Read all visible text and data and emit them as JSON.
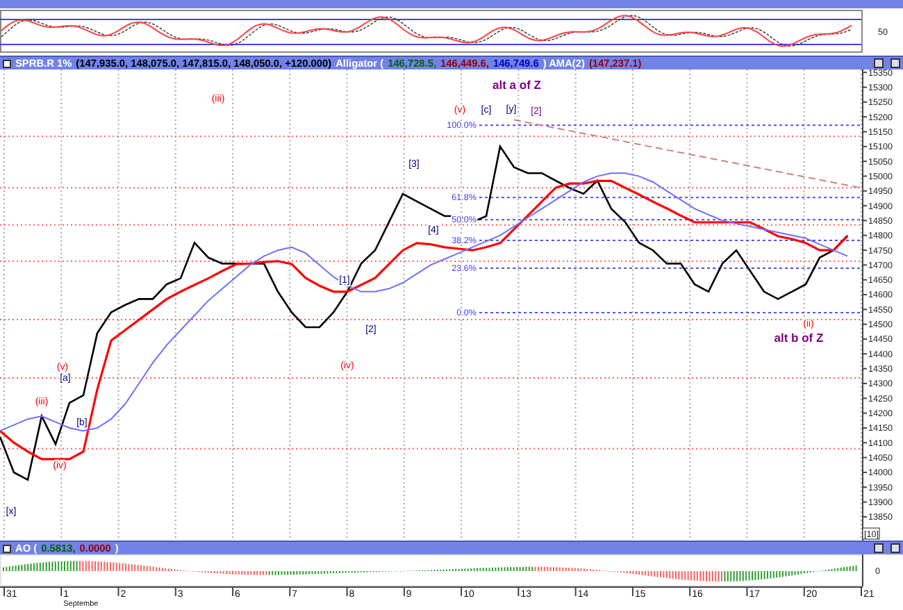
{
  "stochastic_panel": {
    "axis_labels": [
      "50"
    ]
  },
  "price_header": {
    "segments": [
      {
        "text": "SPRB.R 1%",
        "color": "#ffffff"
      },
      {
        "text": "(147,935.0, 148,075.0, 147,815.0, 148,050.0, +120.000)",
        "color": "#000000"
      },
      {
        "text": "Alligator (",
        "color": "#ffffff"
      },
      {
        "text": "146,728.5,",
        "color": "#006600"
      },
      {
        "text": "146,449.6,",
        "color": "#990000"
      },
      {
        "text": "146,749.6",
        "color": "#0000cc"
      },
      {
        "text": ") AMA(2)",
        "color": "#ffffff"
      },
      {
        "text": "(147,237.1)",
        "color": "#990000"
      }
    ]
  },
  "price_chart": {
    "axis_box": "[10]",
    "chart_data": {
      "type": "line",
      "categories": [
        null,
        null,
        null,
        null,
        null,
        null,
        null,
        null,
        null,
        null,
        null,
        null,
        null,
        null,
        null,
        null,
        null,
        null,
        null,
        null,
        null,
        null,
        null,
        null,
        null,
        null,
        null,
        null,
        null,
        null,
        null,
        null,
        null,
        null,
        null,
        null,
        null,
        null,
        null,
        null,
        null,
        null,
        null,
        null,
        null,
        null,
        null,
        null,
        null,
        null,
        null,
        null,
        null,
        null,
        null,
        null,
        null,
        null,
        null,
        null,
        null,
        null
      ],
      "series": [
        {
          "color": "#000000",
          "values": [
            14120,
            14000,
            13975,
            14190,
            14095,
            14235,
            14260,
            14470,
            14540,
            14565,
            14585,
            14585,
            14635,
            14655,
            14775,
            14725,
            14705,
            14705,
            14705,
            14705,
            14610,
            14540,
            14490,
            14490,
            14540,
            14610,
            14705,
            14750,
            14845,
            14940,
            14915,
            14890,
            14865,
            14865,
            14845,
            14865,
            15100,
            15030,
            15010,
            15010,
            14985,
            14960,
            14940,
            14985,
            14890,
            14845,
            14775,
            14750,
            14705,
            14705,
            14635,
            14610,
            14705,
            14750,
            14680,
            14610,
            14585,
            14610,
            14635,
            14725,
            14750,
            14800
          ]
        },
        {
          "color": "#ff0000",
          "values": [
            14140,
            14100,
            14070,
            14045,
            14045,
            14045,
            14070,
            14280,
            14445,
            14480,
            14515,
            14550,
            14585,
            14610,
            14633,
            14655,
            14680,
            14703,
            14705,
            14710,
            14713,
            14703,
            14656,
            14630,
            14610,
            14610,
            14633,
            14656,
            14703,
            14750,
            14774,
            14770,
            14760,
            14755,
            14750,
            14760,
            14774,
            14821,
            14867,
            14914,
            14961,
            14975,
            14975,
            14984,
            14984,
            14961,
            14938,
            14914,
            14891,
            14867,
            14844,
            14844,
            14844,
            14844,
            14844,
            14821,
            14797,
            14788,
            14774,
            14750,
            14750,
            14797
          ]
        },
        {
          "color": "#6f6fff",
          "values": [
            14140,
            14160,
            14180,
            14190,
            14170,
            14150,
            14140,
            14150,
            14180,
            14230,
            14300,
            14370,
            14430,
            14480,
            14530,
            14580,
            14620,
            14660,
            14700,
            14730,
            14750,
            14760,
            14740,
            14700,
            14660,
            14630,
            14610,
            14610,
            14620,
            14640,
            14670,
            14700,
            14720,
            14740,
            14760,
            14780,
            14800,
            14830,
            14860,
            14890,
            14920,
            14950,
            14980,
            15000,
            15010,
            15010,
            15000,
            14980,
            14950,
            14920,
            14890,
            14870,
            14850,
            14840,
            14830,
            14820,
            14810,
            14800,
            14790,
            14770,
            14750,
            14730
          ]
        }
      ],
      "ylim": [
        13770,
        15360
      ],
      "grid": true,
      "ref_lines": [
        {
          "axis": "y",
          "value": 15134
        },
        {
          "axis": "y",
          "value": 14961
        },
        {
          "axis": "y",
          "value": 14835
        },
        {
          "axis": "y",
          "value": 14713
        },
        {
          "axis": "y",
          "value": 14516
        },
        {
          "axis": "y",
          "value": 14319
        },
        {
          "axis": "y",
          "value": 14080
        },
        {
          "axis": "y",
          "value": 15172
        },
        {
          "axis": "y",
          "value": 14928
        },
        {
          "axis": "y",
          "value": 14853
        },
        {
          "axis": "y",
          "value": 14783
        },
        {
          "axis": "y",
          "value": 14689
        },
        {
          "axis": "y",
          "value": 14539
        }
      ],
      "yticks": [
        15350,
        15300,
        15250,
        15200,
        15150,
        15100,
        15050,
        15000,
        14950,
        14900,
        14850,
        14800,
        14750,
        14700,
        14650,
        14600,
        14550,
        14500,
        14450,
        14400,
        14350,
        14300,
        14250,
        14200,
        14150,
        14100,
        14050,
        14000,
        13950,
        13900,
        13850
      ]
    }
  },
  "fibonacci_labels": [
    {
      "text": "100.0%"
    },
    {
      "text": "61.8%"
    },
    {
      "text": "50.0%"
    },
    {
      "text": "38.2%"
    },
    {
      "text": "23.6%"
    },
    {
      "text": "0.0%"
    }
  ],
  "wave_labels": [
    {
      "text": "[x]",
      "color": "#000080"
    },
    {
      "text": "(iii)",
      "color": "#ff0000"
    },
    {
      "text": "(v)",
      "color": "#ff0000"
    },
    {
      "text": "[a]",
      "color": "#000080"
    },
    {
      "text": "(iv)",
      "color": "#ff0000"
    },
    {
      "text": "[b]",
      "color": "#000080"
    },
    {
      "text": "(iii)",
      "color": "#ff0000"
    },
    {
      "text": "[1]",
      "color": "#000080"
    },
    {
      "text": "(iv)",
      "color": "#ff0000"
    },
    {
      "text": "[2]",
      "color": "#000080"
    },
    {
      "text": "[3]",
      "color": "#000080"
    },
    {
      "text": "[4]",
      "color": "#000080"
    },
    {
      "text": "(v)",
      "color": "#ff0000"
    },
    {
      "text": "alt a of Z",
      "color": "#800080",
      "kind": "scenario"
    },
    {
      "text": "[c]",
      "color": "#000080"
    },
    {
      "text": "[y]",
      "color": "#000080"
    },
    {
      "text": "[2]",
      "color": "#800080"
    },
    {
      "text": "(ii)",
      "color": "#ff0000"
    },
    {
      "text": "alt b of Z",
      "color": "#800080",
      "kind": "scenario"
    }
  ],
  "ao_header": {
    "segments": [
      {
        "text": "AO (",
        "color": "#ffffff"
      },
      {
        "text": "0.5813,",
        "color": "#006600"
      },
      {
        "text": "0.0000",
        "color": "#990000"
      },
      {
        "text": ")",
        "color": "#ffffff"
      }
    ]
  },
  "ao_panel": {
    "axis_labels": [
      "0"
    ]
  },
  "date_axis": {
    "labels": [
      "31",
      "1",
      "2",
      "3",
      "6",
      "7",
      "8",
      "9",
      "10",
      "13",
      "14",
      "15",
      "16",
      "17",
      "20",
      "21"
    ],
    "month": "Septembe"
  }
}
